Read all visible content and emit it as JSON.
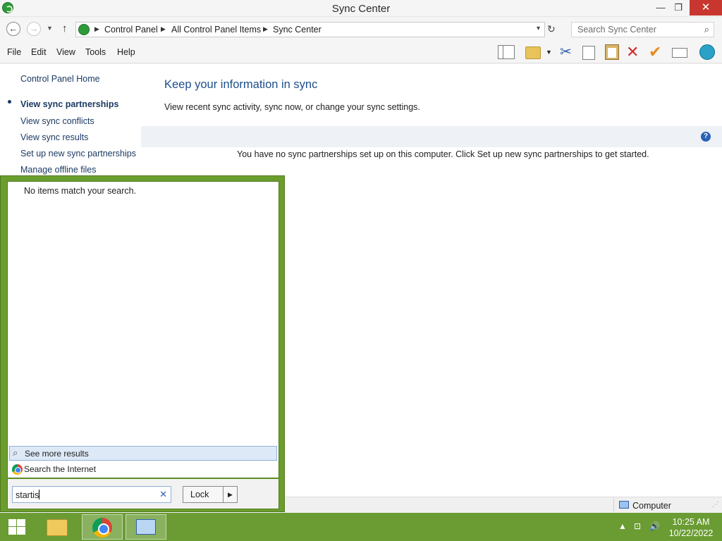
{
  "window": {
    "title": "Sync Center",
    "minimize": "—",
    "maximize": "❐",
    "close": "✕"
  },
  "address_bar": {
    "crumbs": [
      "Control Panel",
      "All Control Panel Items",
      "Sync Center"
    ],
    "separator": "▶",
    "search_placeholder": "Search Sync Center"
  },
  "menu": {
    "items": [
      "File",
      "Edit",
      "View",
      "Tools",
      "Help"
    ]
  },
  "toolbar": {
    "icons": [
      "layout-pane-icon",
      "folder-check-icon",
      "cut-icon",
      "copy-icon",
      "paste-icon",
      "delete-icon",
      "checkmark-icon",
      "properties-icon",
      "globe-icon"
    ]
  },
  "left_pane": {
    "home": "Control Panel Home",
    "links": [
      {
        "label": "View sync partnerships",
        "active": true
      },
      {
        "label": "View sync conflicts",
        "active": false
      },
      {
        "label": "View sync results",
        "active": false
      },
      {
        "label": "Set up new sync partnerships",
        "active": false
      },
      {
        "label": "Manage offline files",
        "active": false
      }
    ]
  },
  "main": {
    "heading": "Keep your information in sync",
    "subtext": "View recent sync activity, sync now, or change your sync settings.",
    "empty_message": "You have no sync partnerships set up on this computer. Click Set up new sync partnerships to get started."
  },
  "status_bar": {
    "location": "Computer"
  },
  "start_search": {
    "no_items": "No items match your search.",
    "see_more": "See more results",
    "search_internet": "Search the Internet",
    "query": "startis",
    "power_button": "Lock"
  },
  "taskbar": {
    "time": "10:25 AM",
    "date": "10/22/2022",
    "accent": "#6a9c33"
  }
}
